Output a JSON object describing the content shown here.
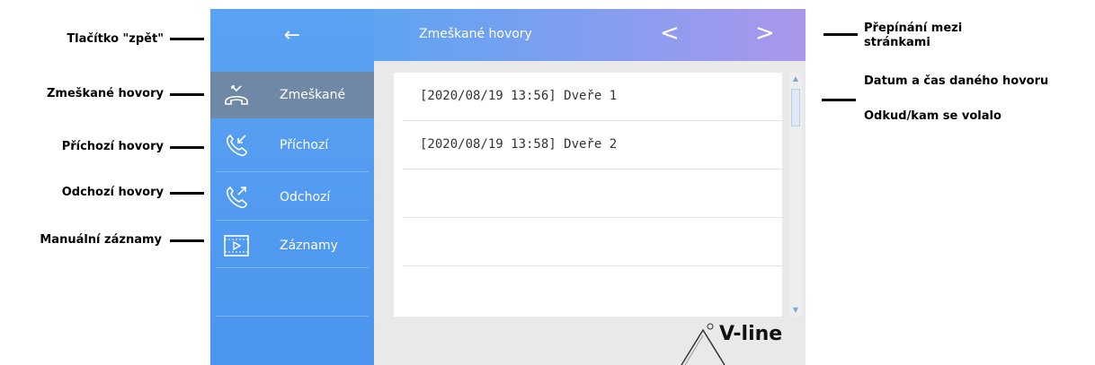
{
  "annotations": {
    "back_button": "Tlačítko \"zpět\"",
    "missed_calls": "Zmeškané hovory",
    "incoming_calls": "Příchozí hovory",
    "outgoing_calls": "Odchozí hovory",
    "manual_records": "Manuální záznamy",
    "page_switch_line1": "Přepínání mezi",
    "page_switch_line2": "stránkami",
    "datetime": "Datum a čas daného hovoru",
    "from_to": "Odkud/kam se volalo"
  },
  "header": {
    "back_icon": "←",
    "title": "Zmeškané hovory",
    "prev_icon": "<",
    "next_icon": ">"
  },
  "sidebar": {
    "items": [
      {
        "label": "Zmeškané",
        "icon": "missed-call-icon"
      },
      {
        "label": "Příchozí",
        "icon": "incoming-call-icon"
      },
      {
        "label": "Odchozí",
        "icon": "outgoing-call-icon"
      },
      {
        "label": "Záznamy",
        "icon": "video-record-icon"
      }
    ]
  },
  "calls": [
    "[2020/08/19 13:56] Dveře 1",
    "[2020/08/19 13:58] Dveře 2"
  ],
  "scrollbar": {
    "up": "▲",
    "down": "▼"
  },
  "logo": {
    "text": "V-line"
  },
  "colors": {
    "sidebar": "#4b95f0",
    "active_item": "#6f88a6",
    "header_start": "#5da4f1",
    "header_end": "#ab97ec",
    "content_bg": "#e9e9e9"
  }
}
